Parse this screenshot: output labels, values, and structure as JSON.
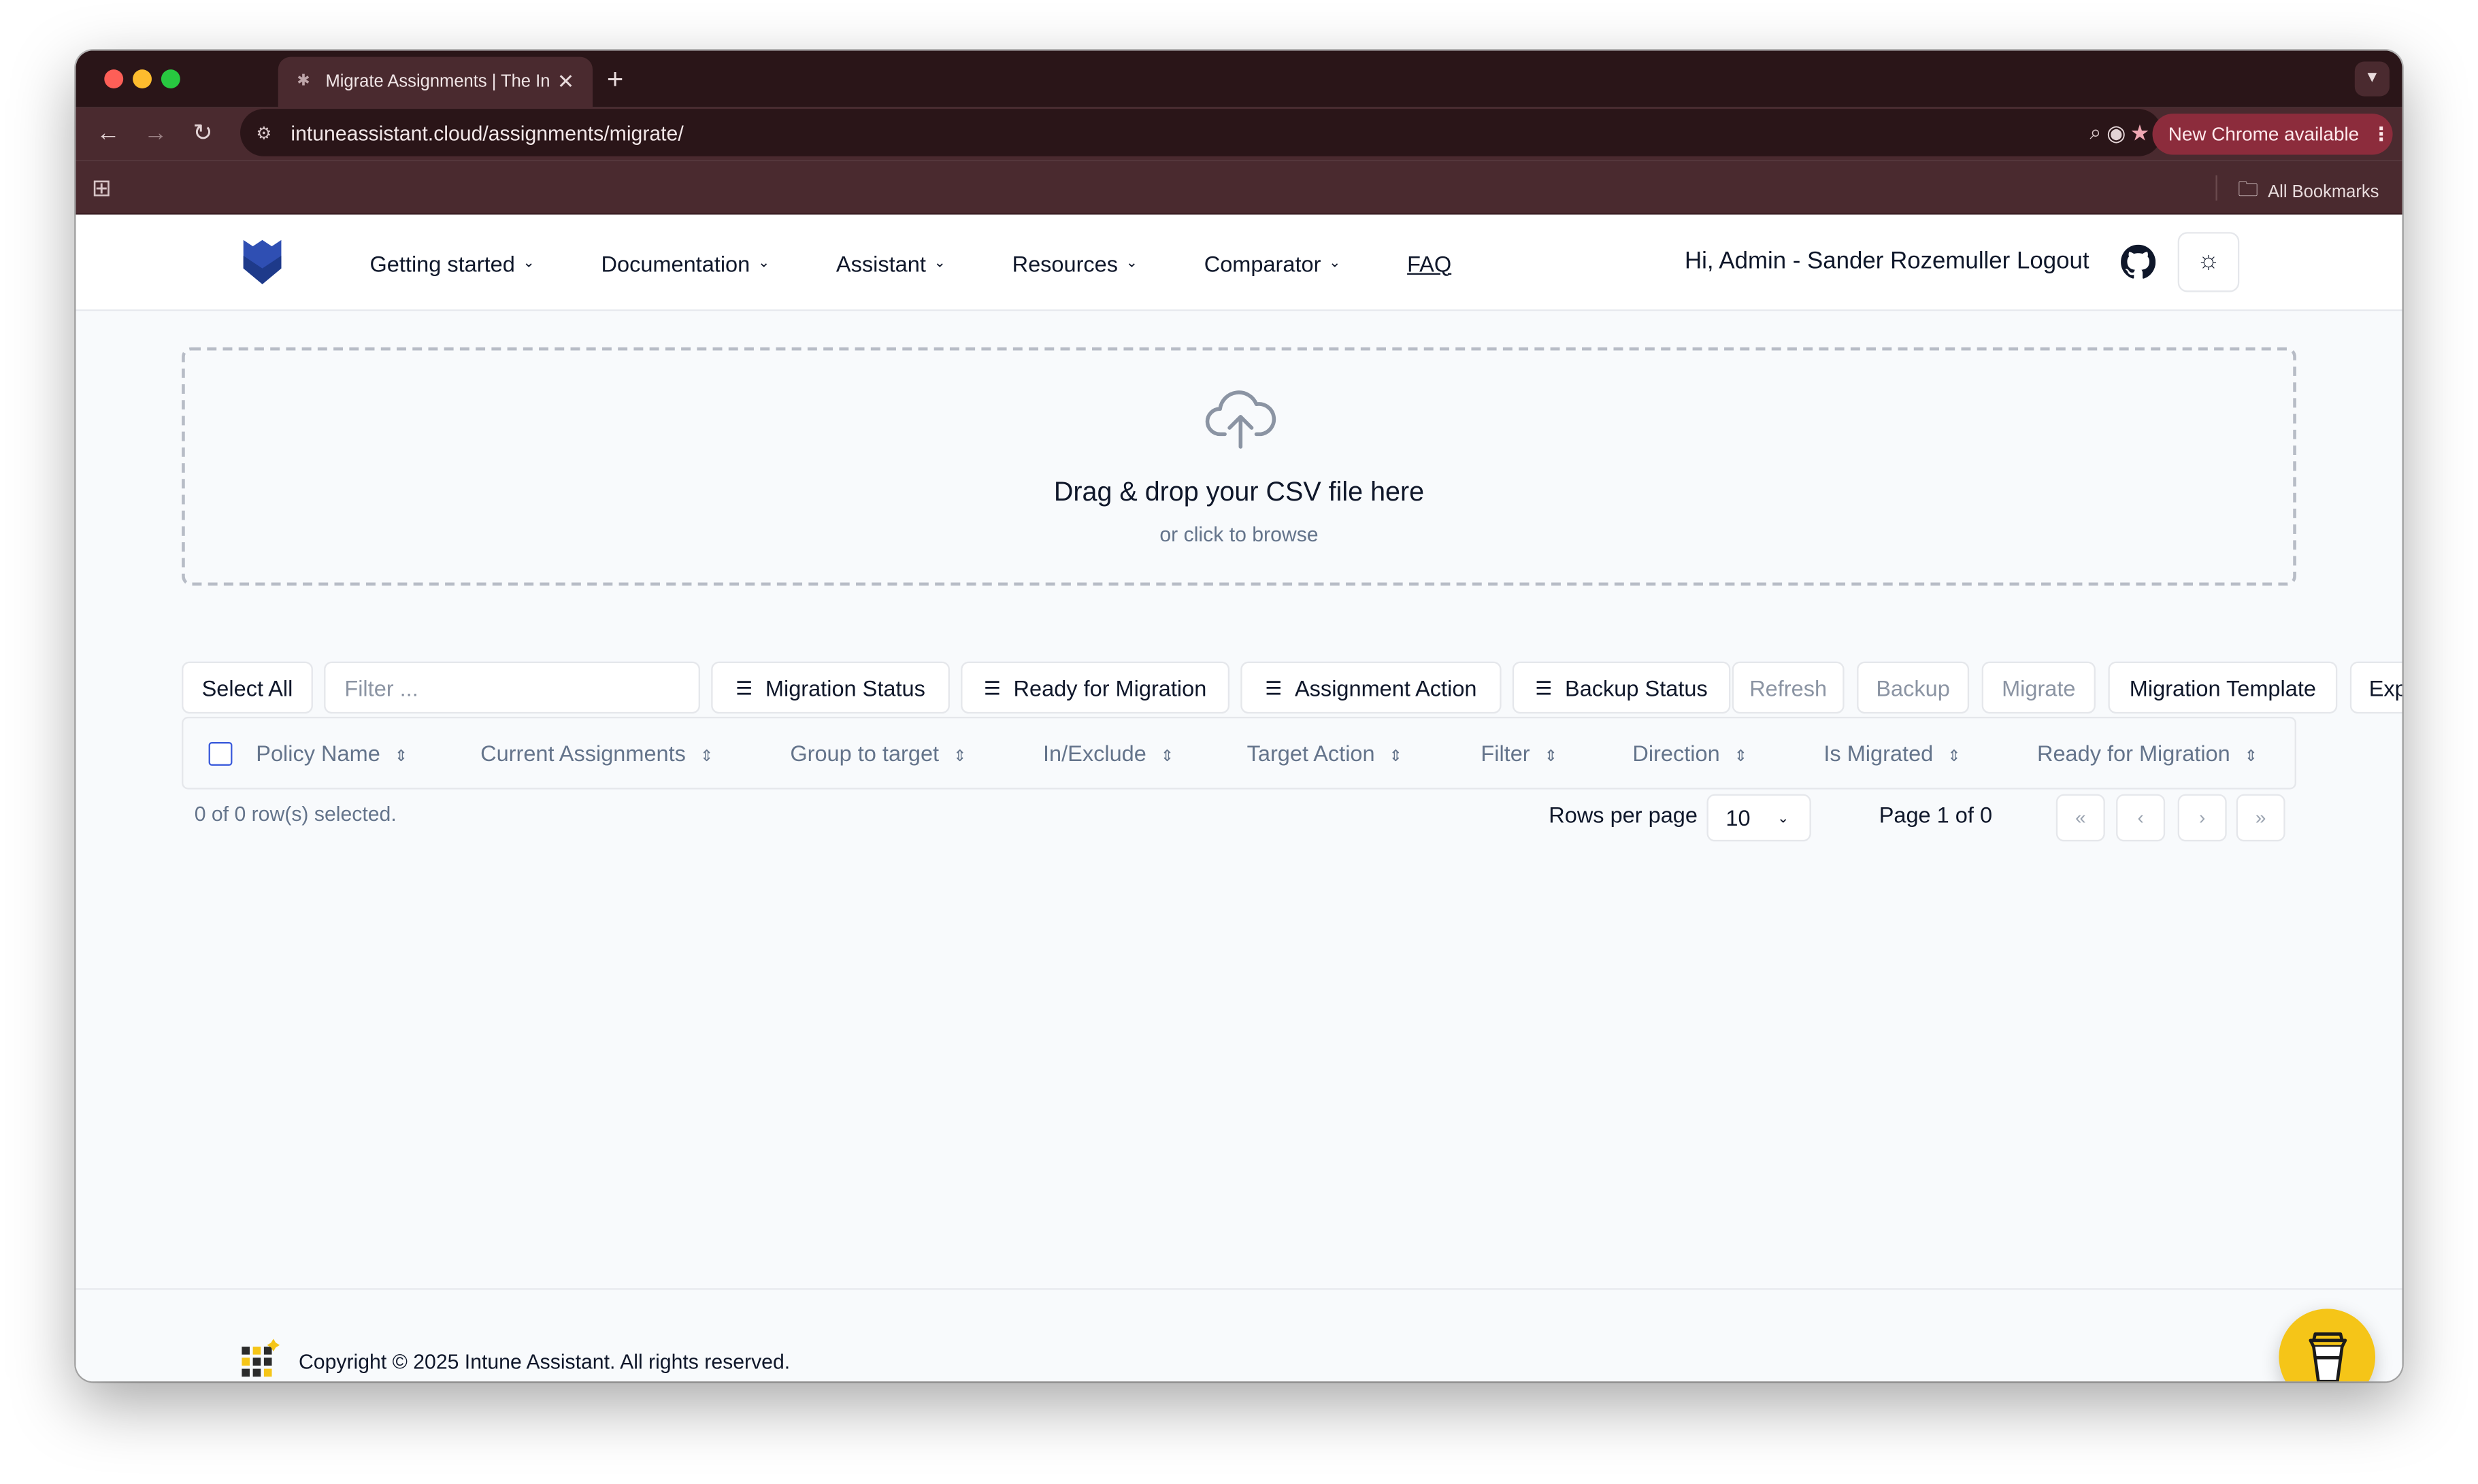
{
  "browser": {
    "tab_title": "Migrate Assignments | The In",
    "tab_close": "✕",
    "new_tab": "+",
    "url": "intuneassistant.cloud/assignments/migrate/",
    "update_label": "New Chrome available",
    "bookmarks_label": "All Bookmarks"
  },
  "header": {
    "nav": [
      {
        "label": "Getting started"
      },
      {
        "label": "Documentation"
      },
      {
        "label": "Assistant"
      },
      {
        "label": "Resources"
      },
      {
        "label": "Comparator"
      }
    ],
    "faq": "FAQ",
    "greeting": "Hi, Admin - Sander Rozemuller Logout"
  },
  "dropzone": {
    "title": "Drag & drop your CSV file here",
    "subtitle": "or click to browse"
  },
  "toolbar": {
    "select_all": "Select All",
    "filter_placeholder": "Filter ...",
    "migration_status": "Migration Status",
    "ready_for_migration": "Ready for Migration",
    "assignment_action": "Assignment Action",
    "backup_status": "Backup Status",
    "refresh": "Refresh",
    "backup": "Backup",
    "migrate": "Migrate",
    "migration_template": "Migration Template",
    "export": "Exp"
  },
  "table": {
    "columns": [
      "Policy Name",
      "Current Assignments",
      "Group to target",
      "In/Exclude",
      "Target Action",
      "Filter",
      "Direction",
      "Is Migrated",
      "Ready for Migration"
    ]
  },
  "pagination": {
    "selected": "0 of 0 row(s) selected.",
    "rows_per_page_label": "Rows per page",
    "rows_per_page_value": "10",
    "page_info": "Page 1 of 0"
  },
  "footer": {
    "copyright": "Copyright © 2025 Intune Assistant. All rights reserved."
  },
  "colors": {
    "chrome_frame": "#4a2a2f",
    "update_pill": "#8c2c3c",
    "brand_blue": "#3b5bdb",
    "coffee_yellow": "#f5c518"
  }
}
